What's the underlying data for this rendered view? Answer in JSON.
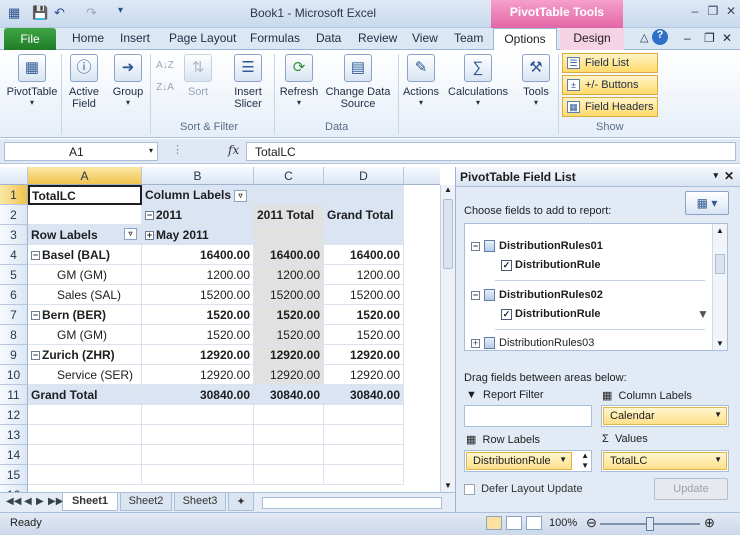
{
  "window": {
    "title": "Book1 - Microsoft Excel",
    "contextual_tab": "PivotTable Tools"
  },
  "ribbon_tabs": [
    "File",
    "Home",
    "Insert",
    "Page Layout",
    "Formulas",
    "Data",
    "Review",
    "View",
    "Team",
    "Options",
    "Design"
  ],
  "ribbon": {
    "pivottable": "PivotTable",
    "active_field": "Active Field",
    "group": "Group",
    "sort": "Sort",
    "insert_slicer": "Insert Slicer",
    "refresh": "Refresh",
    "change_data_source": "Change Data Source",
    "actions": "Actions",
    "calculations": "Calculations",
    "tools": "Tools",
    "field_list": "Field List",
    "pm_buttons": "+/- Buttons",
    "field_headers": "Field Headers",
    "group_sort_filter": "Sort & Filter",
    "group_data": "Data",
    "group_show": "Show"
  },
  "formula_bar": {
    "name_box": "A1",
    "fx": "fx",
    "formula": "TotalLC"
  },
  "grid": {
    "columns": [
      "A",
      "B",
      "C",
      "D"
    ],
    "rows": [
      "1",
      "2",
      "3",
      "4",
      "5",
      "6",
      "7",
      "8",
      "9",
      "10",
      "11",
      "12",
      "13",
      "14",
      "15",
      "16"
    ],
    "r1": {
      "a": "TotalLC",
      "b": "Column Labels"
    },
    "r2": {
      "b": "2011",
      "c": "2011 Total",
      "d": "Grand Total"
    },
    "r3": {
      "a": "Row Labels",
      "b": "May 2011"
    },
    "r4": {
      "a": "Basel (BAL)",
      "b": "16400.00",
      "c": "16400.00",
      "d": "16400.00"
    },
    "r5": {
      "a": "GM (GM)",
      "b": "1200.00",
      "c": "1200.00",
      "d": "1200.00"
    },
    "r6": {
      "a": "Sales (SAL)",
      "b": "15200.00",
      "c": "15200.00",
      "d": "15200.00"
    },
    "r7": {
      "a": "Bern (BER)",
      "b": "1520.00",
      "c": "1520.00",
      "d": "1520.00"
    },
    "r8": {
      "a": "GM (GM)",
      "b": "1520.00",
      "c": "1520.00",
      "d": "1520.00"
    },
    "r9": {
      "a": "Zurich (ZHR)",
      "b": "12920.00",
      "c": "12920.00",
      "d": "12920.00"
    },
    "r10": {
      "a": "Service (SER)",
      "b": "12920.00",
      "c": "12920.00",
      "d": "12920.00"
    },
    "r11": {
      "a": "Grand Total",
      "b": "30840.00",
      "c": "30840.00",
      "d": "30840.00"
    }
  },
  "sheets": [
    "Sheet1",
    "Sheet2",
    "Sheet3"
  ],
  "field_list": {
    "title": "PivotTable Field List",
    "choose": "Choose fields to add to report:",
    "fields": [
      {
        "name": "DistributionRules01",
        "child": "DistributionRule"
      },
      {
        "name": "DistributionRules02",
        "child": "DistributionRule"
      },
      {
        "name": "DistributionRules03"
      }
    ],
    "drag_label": "Drag fields between areas below:",
    "report_filter": "Report Filter",
    "column_labels": "Column Labels",
    "row_labels": "Row Labels",
    "values": "Values",
    "column_value": "Calendar",
    "row_value": "DistributionRule",
    "values_value": "TotalLC",
    "defer": "Defer Layout Update",
    "update": "Update"
  },
  "status": {
    "ready": "Ready",
    "zoom": "100%"
  }
}
